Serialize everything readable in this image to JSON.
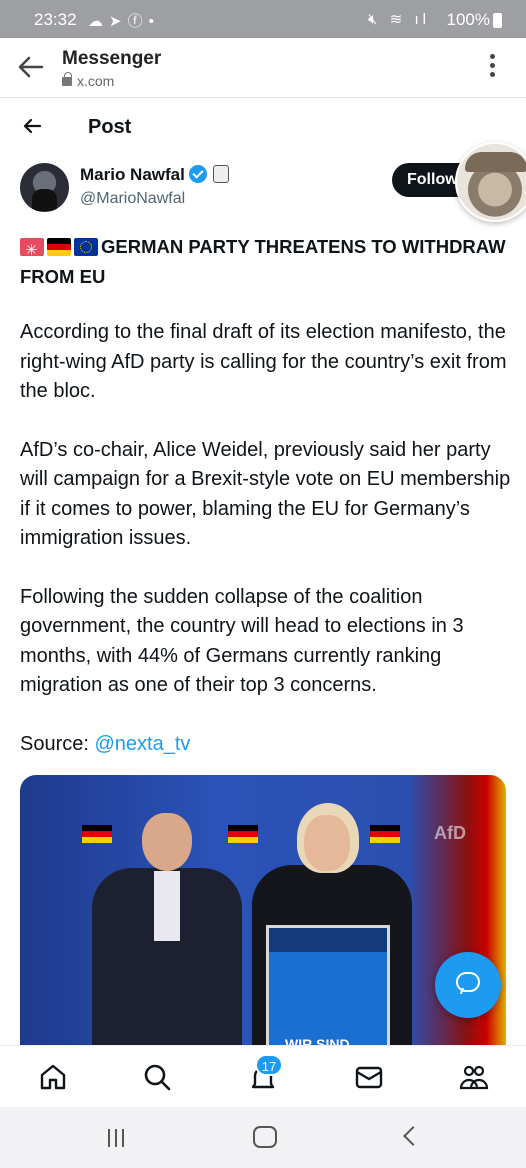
{
  "status_bar": {
    "time": "23:32",
    "battery": "100%"
  },
  "browser": {
    "title": "Messenger",
    "url": "x.com"
  },
  "post_header": {
    "title": "Post"
  },
  "author": {
    "name": "Mario Nawfal",
    "handle": "@MarioNawfal",
    "follow_label": "Follow"
  },
  "post": {
    "headline": "GERMAN PARTY THREATENS TO WITHDRAW FROM EU",
    "paragraphs": [
      "According to the final draft of its election manifesto, the right-wing AfD party is calling for the country’s exit from the bloc.",
      "AfD’s co-chair, Alice Weidel, previously said her party will campaign for a Brexit-style vote on EU membership if it comes to power, blaming the EU for Germany’s immigration issues.",
      "Following the sudden collapse of the coalition government, the country will head to elections in 3 months, with 44% of Germans currently ranking migration as one of their top 3 concerns."
    ],
    "source_label": "Source: ",
    "source_link": "@nexta_tv"
  },
  "media": {
    "podium_text": "WIR SIND",
    "banner_text": "AfD"
  },
  "bottom_nav": {
    "notifications_count": "17"
  },
  "colors": {
    "accent": "#1d9bf0",
    "text": "#0f1419",
    "muted": "#536471"
  }
}
